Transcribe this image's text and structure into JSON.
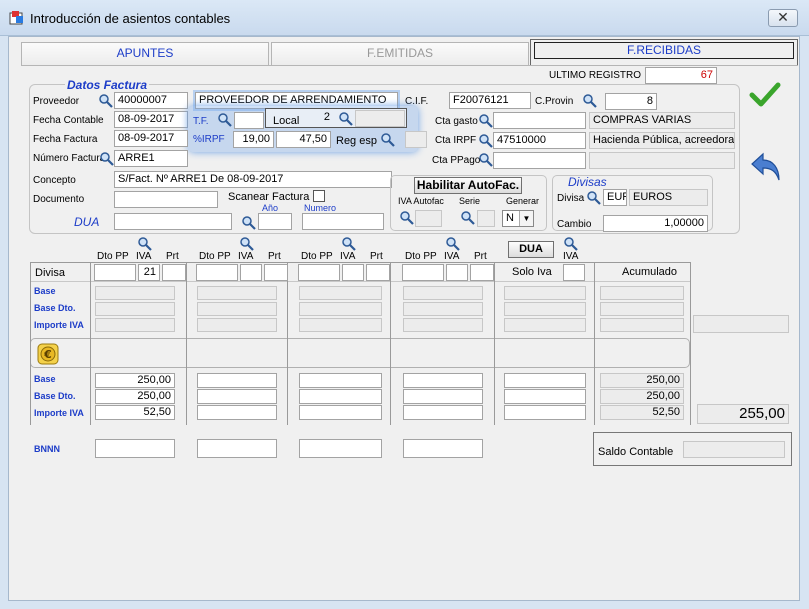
{
  "window": {
    "title": "Introducción de asientos contables",
    "close": "✕"
  },
  "tabs": [
    "APUNTES",
    "F.EMITIDAS",
    "F.RECIBIDAS"
  ],
  "ultimo": {
    "label": "ULTIMO REGISTRO",
    "value": "67"
  },
  "factura": {
    "group": "Datos Factura",
    "proveedor_label": "Proveedor",
    "proveedor": "40000007",
    "proveedor_name": "PROVEEDOR DE ARRENDAMIENTO",
    "cif_label": "C.I.F.",
    "cif": "F20076121",
    "cprovin_label": "C.Provin",
    "cprovin": "8",
    "fecha_contable_label": "Fecha Contable",
    "fecha_contable": "08-09-2017",
    "tf_label": "T.F.",
    "local_label": "Local",
    "local_value": "2",
    "fecha_factura_label": "Fecha Factura",
    "fecha_factura": "08-09-2017",
    "irpf_label": "%IRPF",
    "irpf_pct": "19,00",
    "irpf_amount": "47,50",
    "regesp_label": "Reg esp",
    "numero_label": "Número Factura",
    "numero": "ARRE1",
    "concepto_label": "Concepto",
    "concepto": "S/Fact. Nº ARRE1 De 08-09-2017",
    "documento_label": "Documento",
    "scanear_label": "Scanear Factura",
    "dua_label": "DUA",
    "anio_label": "Año",
    "numero2_label": "Numero",
    "cta_gasto_label": "Cta gasto",
    "cta_gasto_name": "COMPRAS VARIAS",
    "cta_irpf_label": "Cta  IRPF",
    "cta_irpf": "47510000",
    "cta_irpf_name": "Hacienda Pública, acreedora",
    "cta_ppago_label": "Cta PPago"
  },
  "autofac": {
    "button": "Habilitar AutoFac.",
    "iva_label": "IVA Autofac",
    "serie_label": "Serie",
    "generar_label": "Generar",
    "generar_value": "N"
  },
  "divisas": {
    "title": "Divisas",
    "divisa_label": "Divisa",
    "code": "EUR",
    "name": "EUROS",
    "cambio_label": "Cambio",
    "cambio": "1,00000"
  },
  "iva_headers": {
    "dto": "Dto PP",
    "iva": "IVA",
    "prt": "Prt",
    "dua_button": "DUA"
  },
  "table": {
    "divisa_label": "Divisa",
    "solo_iva": "Solo Iva",
    "acumulado": "Acumulado",
    "iva1": "21",
    "rows_top": [
      "Base",
      "Base Dto.",
      "Importe IVA"
    ],
    "rows_bottom": [
      "Base",
      "Base Dto.",
      "Importe IVA"
    ],
    "col1": [
      "250,00",
      "250,00",
      "52,50"
    ],
    "acum": [
      "250,00",
      "250,00",
      "52,50"
    ],
    "total": "255,00"
  },
  "bnnn": "BNNN",
  "saldo_label": "Saldo Contable"
}
